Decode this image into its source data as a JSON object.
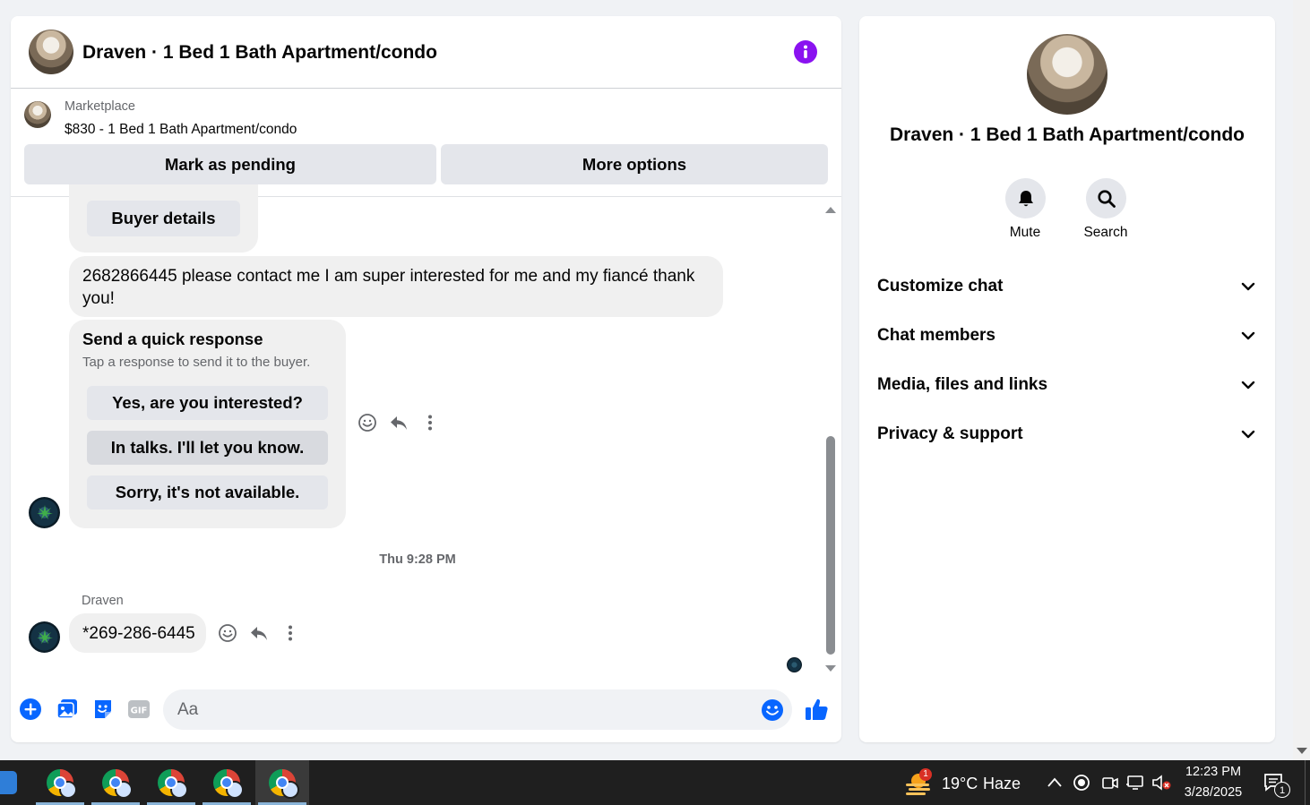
{
  "conversation": {
    "title": "Draven · 1 Bed 1 Bath Apartment/condo",
    "listing": {
      "source": "Marketplace",
      "summary": "$830 - 1 Bed 1 Bath Apartment/condo"
    },
    "actions": {
      "mark_pending": "Mark as pending",
      "more_options": "More options"
    }
  },
  "messages": {
    "buyer_details_button": "Buyer details",
    "contact_message": "2682866445 please contact me I am super interested for me and my fiancé thank you!",
    "quick_response": {
      "title": "Send a quick response",
      "subtitle": "Tap a response to send it to the buyer.",
      "options": [
        "Yes, are you interested?",
        "In talks. I'll let you know.",
        "Sorry, it's not available."
      ]
    },
    "timestamp": "Thu 9:28 PM",
    "sender_name": "Draven",
    "last_message": "*269-286-6445"
  },
  "composer": {
    "placeholder": "Aa"
  },
  "details": {
    "title": "Draven · 1 Bed 1 Bath Apartment/condo",
    "mute_label": "Mute",
    "search_label": "Search",
    "sections": [
      "Customize chat",
      "Chat members",
      "Media, files and links",
      "Privacy & support"
    ]
  },
  "taskbar": {
    "weather_temp": "19°C",
    "weather_desc": "Haze",
    "weather_badge": "1",
    "time": "12:23 PM",
    "date": "3/28/2025",
    "notification_count": "1"
  },
  "colors": {
    "accent_blue": "#0866ff",
    "info_purple": "#8a12f0",
    "bubble_gray": "#f0f0f0",
    "button_gray": "#e4e6eb"
  }
}
